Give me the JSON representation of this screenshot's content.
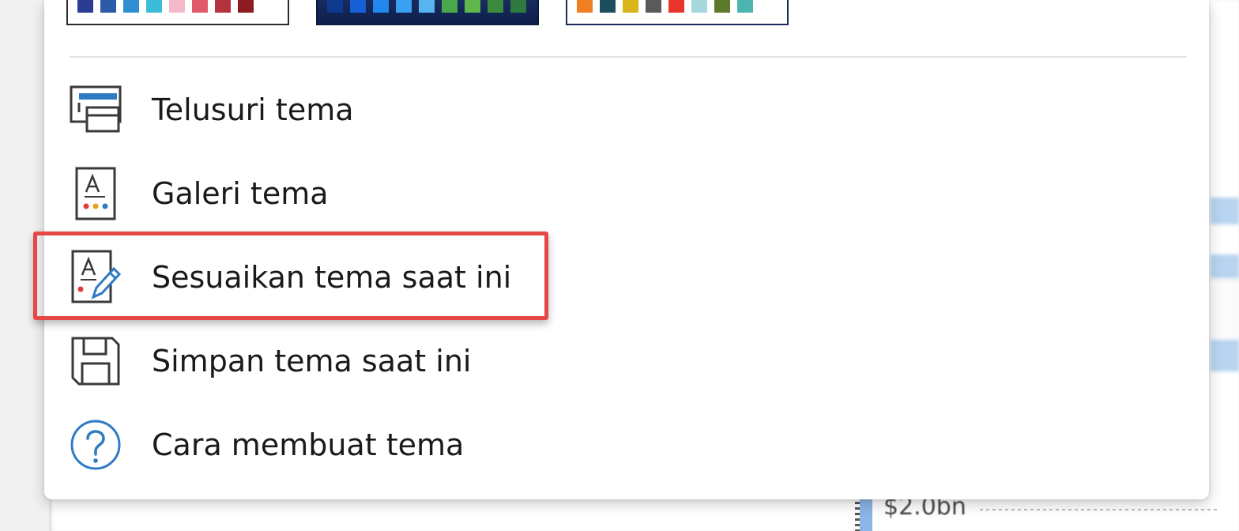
{
  "theme_swatches": [
    {
      "name": "light-theme-swatch",
      "colors": [
        "#2c3b94",
        "#2a5aa8",
        "#2f8fd0",
        "#3cbcd8",
        "#f4b8c8",
        "#e05a6a",
        "#b5323f",
        "#8e1a22"
      ]
    },
    {
      "name": "dark-theme-swatch",
      "colors": [
        "#0c3a8e",
        "#1560d4",
        "#2288ee",
        "#3aa0f4",
        "#58b4f0",
        "#4aa84c",
        "#5fb64a",
        "#3c8a40",
        "#2f7a3e"
      ]
    },
    {
      "name": "colorful-theme-swatch",
      "colors": [
        "#f07f23",
        "#1b4f5e",
        "#d9b51b",
        "#5a5a5a",
        "#e8342a",
        "#a6d9de",
        "#5d7a2a",
        "#4db5b0"
      ]
    }
  ],
  "menu": {
    "items": [
      {
        "id": "browse",
        "label": "Telusuri tema",
        "icon": "browse-themes-icon"
      },
      {
        "id": "gallery",
        "label": "Galeri tema",
        "icon": "theme-gallery-icon"
      },
      {
        "id": "customize",
        "label": "Sesuaikan tema saat ini",
        "icon": "customize-theme-icon",
        "highlighted": true
      },
      {
        "id": "save",
        "label": "Simpan tema saat ini",
        "icon": "save-icon"
      },
      {
        "id": "howto",
        "label": "Cara membuat tema",
        "icon": "help-icon"
      }
    ]
  },
  "background": {
    "amount_label": "$2.0bn"
  },
  "colors": {
    "highlight": "#e64848",
    "icon_blue": "#2e7bc4",
    "text": "#1a1a1a"
  }
}
